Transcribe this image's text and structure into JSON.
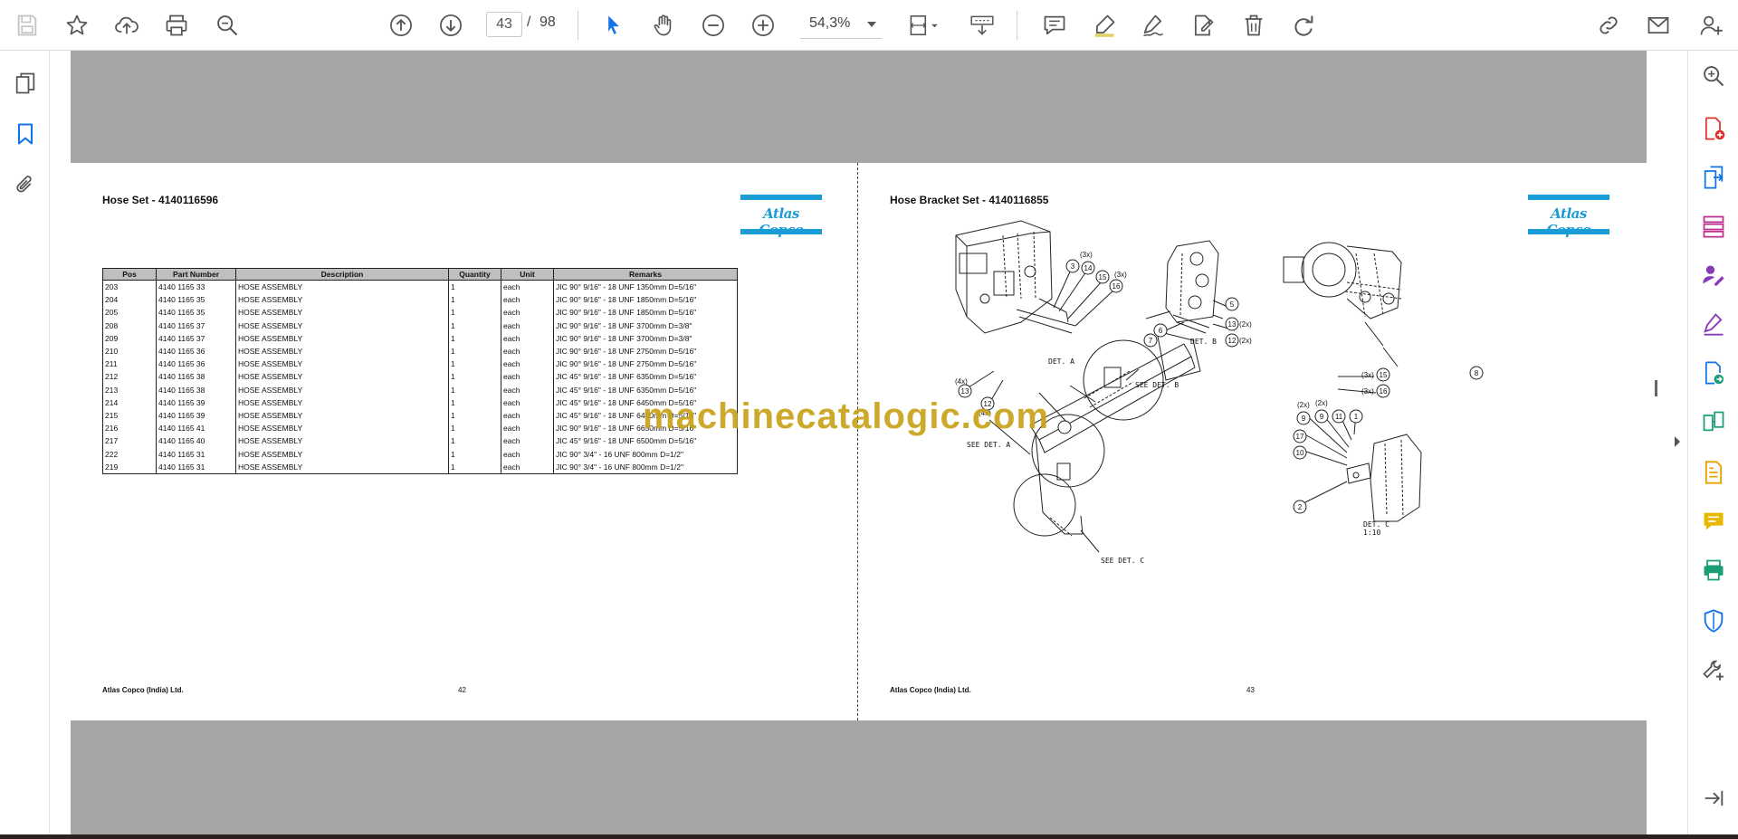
{
  "toolbar": {
    "page_current": "43",
    "page_separator": "/",
    "page_total": "98",
    "zoom_level": "54,3%"
  },
  "watermark": "machinecatalogic.com",
  "left_page": {
    "title": "Hose Set - 4140116596",
    "logo": "Atlas Copco",
    "footer": "Atlas Copco (India) Ltd.",
    "page_number": "42",
    "table": {
      "headers": [
        "Pos",
        "Part Number",
        "Description",
        "Quantity",
        "Unit",
        "Remarks"
      ],
      "rows": [
        [
          "203",
          "4140 1165 33",
          "HOSE ASSEMBLY",
          "1",
          "each",
          "JIC 90° 9/16\" - 18 UNF 1350mm D=5/16\""
        ],
        [
          "204",
          "4140 1165 35",
          "HOSE ASSEMBLY",
          "1",
          "each",
          "JIC 90° 9/16\" - 18 UNF 1850mm D=5/16\""
        ],
        [
          "205",
          "4140 1165 35",
          "HOSE ASSEMBLY",
          "1",
          "each",
          "JIC 90° 9/16\" - 18 UNF 1850mm D=5/16\""
        ],
        [
          "208",
          "4140 1165 37",
          "HOSE ASSEMBLY",
          "1",
          "each",
          "JIC 90° 9/16\" - 18 UNF 3700mm D=3/8\""
        ],
        [
          "209",
          "4140 1165 37",
          "HOSE ASSEMBLY",
          "1",
          "each",
          "JIC 90° 9/16\" - 18 UNF 3700mm D=3/8\""
        ],
        [
          "210",
          "4140 1165 36",
          "HOSE ASSEMBLY",
          "1",
          "each",
          "JIC 90° 9/16\" - 18 UNF 2750mm D=5/16\""
        ],
        [
          "211",
          "4140 1165 36",
          "HOSE ASSEMBLY",
          "1",
          "each",
          "JIC 90° 9/16\" - 18 UNF 2750mm D=5/16\""
        ],
        [
          "212",
          "4140 1165 38",
          "HOSE ASSEMBLY",
          "1",
          "each",
          "JIC 45° 9/16\" - 18 UNF 6350mm D=5/16\""
        ],
        [
          "213",
          "4140 1165 38",
          "HOSE ASSEMBLY",
          "1",
          "each",
          "JIC 45° 9/16\" - 18 UNF 6350mm D=5/16\""
        ],
        [
          "214",
          "4140 1165 39",
          "HOSE ASSEMBLY",
          "1",
          "each",
          "JIC 45° 9/16\" - 18 UNF 6450mm D=5/16\""
        ],
        [
          "215",
          "4140 1165 39",
          "HOSE ASSEMBLY",
          "1",
          "each",
          "JIC 45° 9/16\" - 18 UNF 6450mm D=5/16\""
        ],
        [
          "216",
          "4140 1165 41",
          "HOSE ASSEMBLY",
          "1",
          "each",
          "JIC 90° 9/16\" - 18 UNF 6650mm D=5/16\""
        ],
        [
          "217",
          "4140 1165 40",
          "HOSE ASSEMBLY",
          "1",
          "each",
          "JIC 45° 9/16\" - 18 UNF 6500mm D=5/16\""
        ],
        [
          "222",
          "4140 1165 31",
          "HOSE ASSEMBLY",
          "1",
          "each",
          "JIC 90° 3/4\" - 16 UNF 800mm D=1/2\""
        ],
        [
          "219",
          "4140 1165 31",
          "HOSE ASSEMBLY",
          "1",
          "each",
          "JIC 90° 3/4\" - 16 UNF 800mm D=1/2\""
        ]
      ]
    }
  },
  "right_page": {
    "title": "Hose Bracket Set - 4140116855",
    "logo": "Atlas Copco",
    "footer": "Atlas Copco (India) Ltd.",
    "page_number": "43",
    "diagram_labels": {
      "det_a": "DET. A",
      "det_b": "DET. B",
      "det_c": "DET. C",
      "det_c_scale": "1:10",
      "see_det_a": "SEE DET. A",
      "see_det_b": "SEE DET. B",
      "see_det_c": "SEE DET. C"
    },
    "callouts_a": {
      "c3": "3",
      "c14": "14",
      "c15": "15",
      "c16": "16",
      "c13": "13",
      "c12": "12",
      "q3x_a": "(3x)",
      "q3x_b": "(3x)",
      "q4x_a": "(4x)",
      "q4x_b": "(4x)"
    },
    "callouts_b": {
      "c5": "5",
      "c6": "6",
      "c7": "7",
      "c13": "13",
      "c12": "12",
      "q2x_a": "(2x)",
      "q2x_b": "(2x)"
    },
    "callouts_top_right": {
      "c15": "15",
      "c16": "16",
      "c8": "8",
      "q3x_a": "(3x)",
      "q3x_b": "(3x)"
    },
    "callouts_c": {
      "c9a": "9",
      "c9b": "9",
      "c11": "11",
      "c1": "1",
      "c17": "17",
      "c10": "10",
      "c2": "2",
      "q2x_a": "(2x)",
      "q2x_b": "(2x)"
    }
  },
  "colors": {
    "accent_blue": "#1473e6",
    "logo_blue": "#1a9cd6",
    "page_background_gray": "#a6a6a6",
    "watermark": "#c8a21a",
    "tool_icon_purple": "#8a3ab9"
  }
}
